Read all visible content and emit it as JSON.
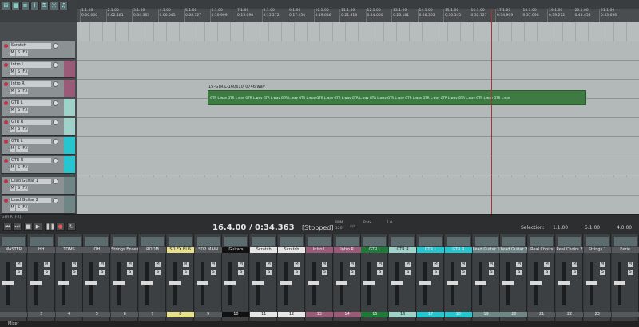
{
  "track_list": [
    {
      "name": "Scratch",
      "color": "#8c9294"
    },
    {
      "name": "Intro L",
      "color": "#9a5a78"
    },
    {
      "name": "Intro R",
      "color": "#9a5a78"
    },
    {
      "name": "GTR L",
      "color": "#9fd2c9"
    },
    {
      "name": "GTR R",
      "color": "#9fd2c9"
    },
    {
      "name": "GTR L",
      "color": "#26c6d1"
    },
    {
      "name": "GTR R",
      "color": "#26c6d1"
    },
    {
      "name": "Lead Guitar 1",
      "color": "#6f8586"
    },
    {
      "name": "Lead Guitar 2",
      "color": "#6f8586"
    }
  ],
  "ruler_ticks": [
    {
      "bar": "1.1.00",
      "time": "0:00.000"
    },
    {
      "bar": "2.1.00",
      "time": "0:02.181"
    },
    {
      "bar": "3.1.00",
      "time": "0:04.363"
    },
    {
      "bar": "4.1.00",
      "time": "0:06.545"
    },
    {
      "bar": "5.1.00",
      "time": "0:08.727"
    },
    {
      "bar": "6.1.00",
      "time": "0:10.909"
    },
    {
      "bar": "7.1.00",
      "time": "0:13.090"
    },
    {
      "bar": "8.1.00",
      "time": "0:15.272"
    },
    {
      "bar": "9.1.00",
      "time": "0:17.454"
    },
    {
      "bar": "10.1.00",
      "time": "0:19.636"
    },
    {
      "bar": "11.1.00",
      "time": "0:21.818"
    },
    {
      "bar": "12.1.00",
      "time": "0:24.000"
    },
    {
      "bar": "13.1.00",
      "time": "0:26.181"
    },
    {
      "bar": "14.1.00",
      "time": "0:28.363"
    },
    {
      "bar": "15.1.00",
      "time": "0:30.545"
    },
    {
      "bar": "16.1.00",
      "time": "0:32.727"
    },
    {
      "bar": "17.1.00",
      "time": "0:34.909"
    },
    {
      "bar": "18.1.00",
      "time": "0:37.090"
    },
    {
      "bar": "19.1.00",
      "time": "0:39.272"
    },
    {
      "bar": "20.1.00",
      "time": "0:41.454"
    },
    {
      "bar": "21.1.00",
      "time": "0:43.636"
    }
  ],
  "media_item": {
    "name": "15-GTR L-160610_0746.wav",
    "segment": "GTR L.wav"
  },
  "transport": {
    "position": "16.4.00 / 0:34.363",
    "state": "[Stopped]",
    "bpm_label": "BPM",
    "bpm": "120",
    "sig": "4/4",
    "rate_label": "Rate",
    "rate": "1.0",
    "sel_label": "Selection:",
    "sel_start": "1.1.00",
    "sel_end": "5.1.00",
    "sel_len": "4.0.00",
    "track_label": "GTR R [FX]"
  },
  "mixer": [
    {
      "name": "MASTER",
      "num": "",
      "color": "#55595c"
    },
    {
      "name": "HH",
      "num": "3",
      "color": "#55595c"
    },
    {
      "name": "TOMS",
      "num": "4",
      "color": "#55595c"
    },
    {
      "name": "OH",
      "num": "5",
      "color": "#55595c"
    },
    {
      "name": "Strings Ensem",
      "num": "6",
      "color": "#55595c"
    },
    {
      "name": "ROOM",
      "num": "7",
      "color": "#55595c"
    },
    {
      "name": "SD FX BUS",
      "num": "8",
      "color": "#e8e08a"
    },
    {
      "name": "SD2 MAIN",
      "num": "9",
      "color": "#55595c"
    },
    {
      "name": "Guitars",
      "num": "10",
      "color": "#111111"
    },
    {
      "name": "Scratch",
      "num": "11",
      "color": "#e6e6e6"
    },
    {
      "name": "Scratch",
      "num": "12",
      "color": "#e6e6e6"
    },
    {
      "name": "Intro L",
      "num": "13",
      "color": "#9a5a78"
    },
    {
      "name": "Intro R",
      "num": "14",
      "color": "#9a5a78"
    },
    {
      "name": "GTR L",
      "num": "15",
      "color": "#1f7a3a"
    },
    {
      "name": "GTR R",
      "num": "16",
      "color": "#9fd2c9"
    },
    {
      "name": "GTR L",
      "num": "17",
      "color": "#26c6d1"
    },
    {
      "name": "GTR R",
      "num": "18",
      "color": "#26c6d1"
    },
    {
      "name": "Lead Guitar 1",
      "num": "19",
      "color": "#6f8586"
    },
    {
      "name": "Lead Guitar 2",
      "num": "20",
      "color": "#6f8586"
    },
    {
      "name": "Real Choirs",
      "num": "21",
      "color": "#55595c"
    },
    {
      "name": "Real Choirs 2",
      "num": "22",
      "color": "#55595c"
    },
    {
      "name": "Strings 1",
      "num": "23",
      "color": "#55595c"
    },
    {
      "name": "Eerie",
      "num": "",
      "color": "#55595c"
    }
  ],
  "mixer_tab": "Mixer"
}
